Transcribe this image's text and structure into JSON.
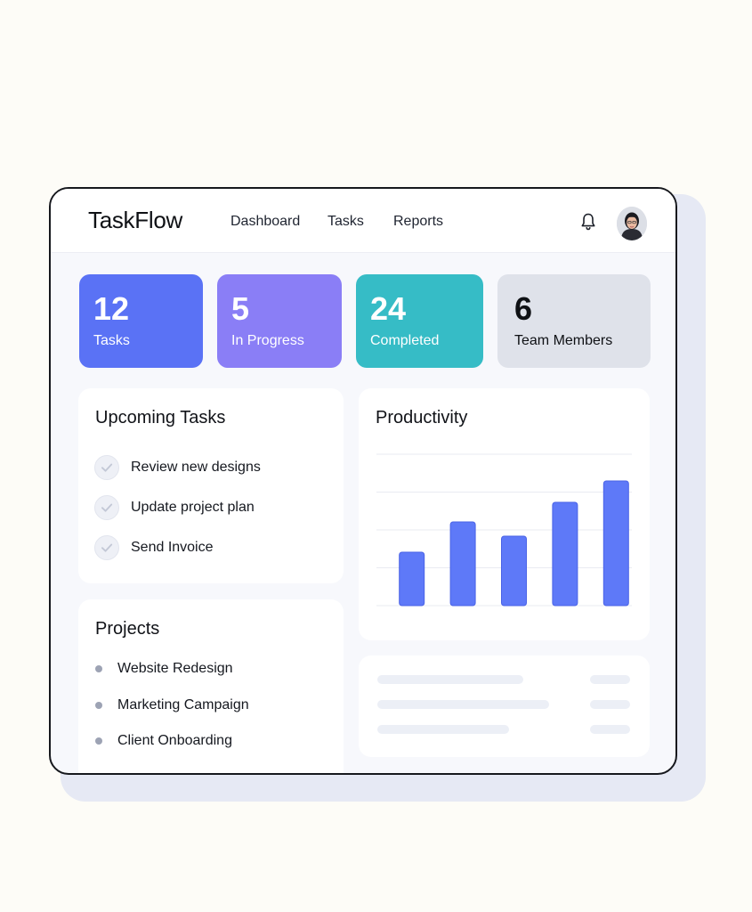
{
  "app": {
    "name": "TaskFlow"
  },
  "nav": {
    "items": [
      "Dashboard",
      "Tasks",
      "Reports"
    ]
  },
  "header": {
    "bell_icon": "bell-icon",
    "avatar_icon": "user-avatar"
  },
  "stats": [
    {
      "value": "12",
      "label": "Tasks",
      "color": "#5a72f5",
      "text_color": "#ffffff"
    },
    {
      "value": "5",
      "label": "In Progress",
      "color": "#8a7ef6",
      "text_color": "#ffffff"
    },
    {
      "value": "24",
      "label": "Completed",
      "color": "#36bcc6",
      "text_color": "#ffffff"
    },
    {
      "value": "6",
      "label": "Team Members",
      "color": "#dfe2ea",
      "text_color": "#0f1115"
    }
  ],
  "upcoming": {
    "title": "Upcoming Tasks",
    "items": [
      "Review new designs",
      "Update project plan",
      "Send Invoice"
    ]
  },
  "projects": {
    "title": "Projects",
    "items": [
      "Website Redesign",
      "Marketing Campaign",
      "Client Onboarding"
    ]
  },
  "productivity": {
    "title": "Productivity"
  },
  "chart_data": {
    "type": "bar",
    "values": [
      30,
      47,
      39,
      58,
      70
    ],
    "ylim": [
      0,
      85
    ],
    "grid": true,
    "bar_color": "#5e79f8"
  }
}
